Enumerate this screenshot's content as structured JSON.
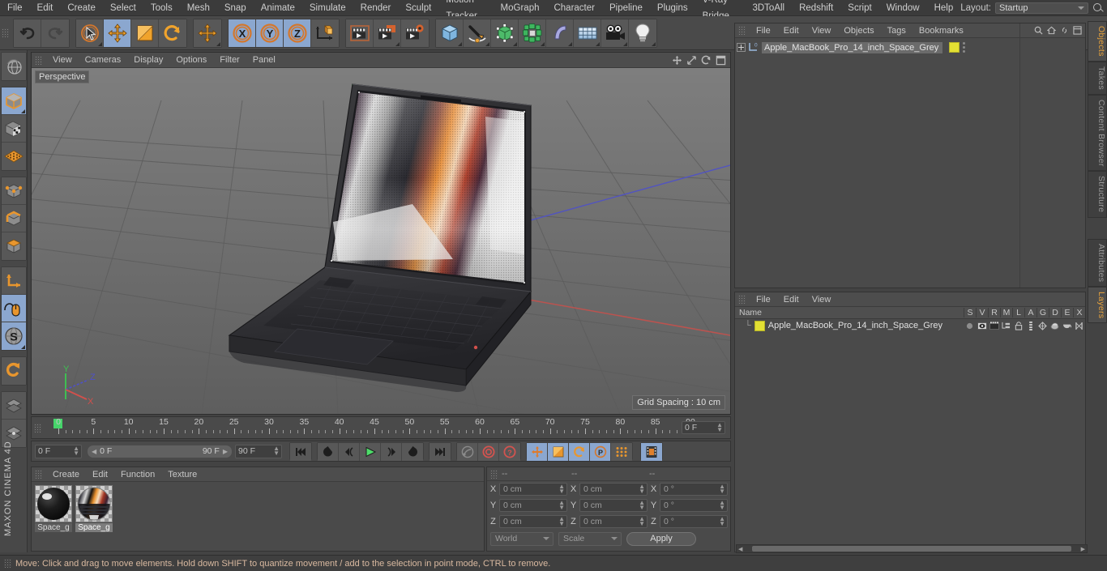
{
  "menu": {
    "items": [
      "File",
      "Edit",
      "Create",
      "Select",
      "Tools",
      "Mesh",
      "Snap",
      "Animate",
      "Simulate",
      "Render",
      "Sculpt",
      "Motion Tracker",
      "MoGraph",
      "Character",
      "Pipeline",
      "Plugins",
      "V-Ray Bridge",
      "3DToAll",
      "Redshift",
      "Script",
      "Window",
      "Help"
    ],
    "layout_label": "Layout:",
    "layout_value": "Startup",
    "search_icon": "search-icon"
  },
  "toolbar": {
    "groups": [
      {
        "name": "history",
        "buttons": [
          {
            "icon": "undo-icon",
            "active": false
          },
          {
            "icon": "redo-icon",
            "active": false,
            "disabled": true
          }
        ]
      },
      {
        "name": "transform",
        "buttons": [
          {
            "icon": "live-selection-icon",
            "active": false,
            "corner": true
          },
          {
            "icon": "move-icon",
            "active": true
          },
          {
            "icon": "scale-icon",
            "active": false
          },
          {
            "icon": "rotate-icon",
            "active": false
          }
        ]
      },
      {
        "name": "move-dup",
        "buttons": [
          {
            "icon": "move-icon",
            "active": false,
            "corner": true
          }
        ]
      },
      {
        "name": "axis-locks",
        "buttons": [
          {
            "icon": "lock-x-icon",
            "active": true
          },
          {
            "icon": "lock-y-icon",
            "active": true
          },
          {
            "icon": "lock-z-icon",
            "active": true
          },
          {
            "icon": "world-coordinate-icon",
            "active": false
          }
        ]
      },
      {
        "name": "render",
        "buttons": [
          {
            "icon": "render-view-icon",
            "active": false
          },
          {
            "icon": "render-to-picture-viewer-icon",
            "active": false,
            "corner": true
          },
          {
            "icon": "render-settings-icon",
            "active": false
          }
        ]
      },
      {
        "name": "create",
        "buttons": [
          {
            "icon": "cube-primitive-icon",
            "active": false,
            "corner": true
          },
          {
            "icon": "spline-pen-icon",
            "active": false,
            "corner": true
          },
          {
            "icon": "nurbs-generator-icon",
            "active": false,
            "corner": true
          },
          {
            "icon": "mograph-cloner-icon",
            "active": false,
            "corner": true
          },
          {
            "icon": "deformer-bend-icon",
            "active": false,
            "corner": true
          },
          {
            "icon": "floor-environment-icon",
            "active": false,
            "corner": true
          },
          {
            "icon": "camera-icon",
            "active": false,
            "corner": true
          },
          {
            "icon": "light-icon",
            "active": false,
            "corner": true
          }
        ]
      }
    ]
  },
  "left_toolbar": {
    "groups": [
      {
        "buttons": [
          {
            "icon": "undo-view-icon",
            "active": false
          }
        ]
      },
      {
        "buttons": [
          {
            "icon": "object-mode-icon",
            "active": true,
            "corner": true
          },
          {
            "icon": "texture-mode-icon",
            "active": false
          },
          {
            "icon": "deformed-editing-icon",
            "active": false
          }
        ]
      },
      {
        "buttons": [
          {
            "icon": "point-mode-icon",
            "active": false
          },
          {
            "icon": "edge-mode-icon",
            "active": false
          },
          {
            "icon": "polygon-mode-icon",
            "active": false
          }
        ]
      },
      {
        "buttons": [
          {
            "icon": "axis-mode-icon",
            "active": false
          },
          {
            "icon": "enable-snapping-icon",
            "active": true
          },
          {
            "icon": "workplane-icon",
            "active": true,
            "corner": true
          }
        ]
      },
      {
        "buttons": [
          {
            "icon": "magnet-icon",
            "active": false
          }
        ]
      },
      {
        "buttons": [
          {
            "icon": "viewport-solo-icon",
            "active": false
          },
          {
            "icon": "viewport-filter-icon",
            "active": false
          }
        ]
      }
    ],
    "brand": "MAXON CINEMA 4D"
  },
  "viewport": {
    "menu": [
      "View",
      "Cameras",
      "Display",
      "Options",
      "Filter",
      "Panel"
    ],
    "label": "Perspective",
    "grid_spacing": "Grid Spacing : 10 cm",
    "axis_gizmo": {
      "x": "X",
      "y": "Y",
      "z": "Z",
      "x_color": "#e05050",
      "y_color": "#4fd44f",
      "z_color": "#5050e0"
    },
    "panel_icons": [
      "viewport-move-icon",
      "viewport-scale-icon",
      "viewport-rotate-icon",
      "viewport-maximize-icon"
    ]
  },
  "timeline": {
    "ticks": [
      0,
      5,
      10,
      15,
      20,
      25,
      30,
      35,
      40,
      45,
      50,
      55,
      60,
      65,
      70,
      75,
      80,
      85,
      90
    ],
    "current_frame_field": "0 F",
    "range_start": "0 F",
    "range_end": "90 F",
    "end_frame_field": "90 F",
    "preview_min": "0 F",
    "playhead_frame": 0
  },
  "playback": {
    "buttons": [
      {
        "icon": "go-to-start-icon",
        "active": false
      },
      {
        "icon": "previous-keyframe-icon",
        "active": false
      },
      {
        "icon": "step-back-icon",
        "active": false
      },
      {
        "icon": "play-icon",
        "active": false
      },
      {
        "icon": "step-forward-icon",
        "active": false
      },
      {
        "icon": "next-keyframe-icon",
        "active": false
      },
      {
        "icon": "go-to-end-icon",
        "active": false
      }
    ],
    "record_buttons": [
      {
        "icon": "record-active-objects-icon",
        "active": false
      },
      {
        "icon": "autokeying-icon",
        "active": false
      },
      {
        "icon": "keyframe-selection-icon",
        "active": false
      }
    ],
    "keying_buttons": [
      {
        "icon": "key-position-icon",
        "active": true
      },
      {
        "icon": "key-scale-icon",
        "active": true
      },
      {
        "icon": "key-rotation-icon",
        "active": true
      },
      {
        "icon": "key-parameter-icon",
        "active": true
      },
      {
        "icon": "key-pla-icon",
        "active": false
      }
    ],
    "timeline_toggle": {
      "icon": "timeline-icon",
      "active": true
    }
  },
  "material_manager": {
    "menu": [
      "Create",
      "Edit",
      "Function",
      "Texture"
    ],
    "materials": [
      {
        "name": "Space_g",
        "selected": false,
        "preview": "dark-sphere"
      },
      {
        "name": "Space_g",
        "selected": true,
        "preview": "screen-texture"
      }
    ]
  },
  "coordinates": {
    "headers": [
      "--",
      "--",
      "--"
    ],
    "rows": [
      {
        "axis": "X",
        "position": "0 cm",
        "size": "0 cm",
        "rotation": "0 °"
      },
      {
        "axis": "Y",
        "position": "0 cm",
        "size": "0 cm",
        "rotation": "0 °"
      },
      {
        "axis": "Z",
        "position": "0 cm",
        "size": "0 cm",
        "rotation": "0 °"
      }
    ],
    "space_select": "World",
    "mode_select": "Scale",
    "apply_label": "Apply"
  },
  "object_manager": {
    "menu": [
      "File",
      "Edit",
      "View",
      "Objects",
      "Tags",
      "Bookmarks"
    ],
    "header_icons": [
      "search-icon",
      "home-icon",
      "link-icon",
      "expand-icon"
    ],
    "object": {
      "name": "Apple_MacBook_Pro_14_inch_Space_Grey",
      "layer_color": "#e3e033",
      "icon": "null-object-icon"
    }
  },
  "layer_manager": {
    "menu": [
      "File",
      "Edit",
      "View"
    ],
    "name_header": "Name",
    "columns": [
      "S",
      "V",
      "R",
      "M",
      "L",
      "A",
      "G",
      "D",
      "E",
      "X"
    ],
    "row": {
      "name": "Apple_MacBook_Pro_14_inch_Space_Grey",
      "swatch_color": "#e3e033",
      "cells": [
        "solo-dot-icon",
        "visibility-icon",
        "render-icon",
        "manager-icon",
        "lock-icon",
        "animation-icon",
        "generator-icon",
        "deformer-icon",
        "expression-icon",
        "xpresso-icon"
      ]
    }
  },
  "vertical_tabs": {
    "top": [
      {
        "label": "Objects",
        "active": true
      },
      {
        "label": "Takes",
        "active": false
      },
      {
        "label": "Content Browser",
        "active": false
      },
      {
        "label": "Structure",
        "active": false
      }
    ],
    "bottom": [
      {
        "label": "Attributes",
        "active": false
      },
      {
        "label": "Layers",
        "active": true
      }
    ]
  },
  "status_bar": {
    "text": "Move: Click and drag to move elements. Hold down SHIFT to quantize movement / add to the selection in point mode, CTRL to remove."
  }
}
